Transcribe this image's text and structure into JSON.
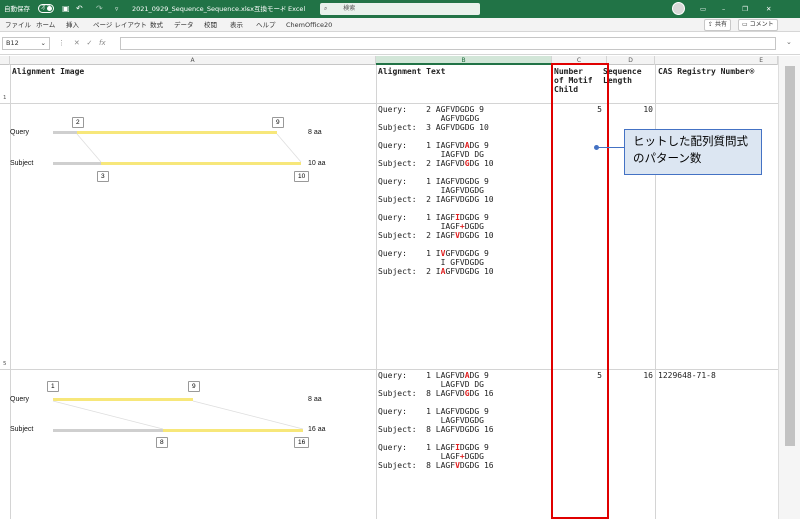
{
  "titlebar": {
    "autosave_label": "自動保存",
    "autosave_state": "オフ",
    "filename": "2021_0929_Sequence_Sequence.xlsx",
    "separator": "-",
    "mode": "互換モード",
    "app": "Excel",
    "search_placeholder": "検索"
  },
  "ribbon": {
    "menus": [
      "ファイル",
      "ホーム",
      "挿入",
      "ページ レイアウト",
      "数式",
      "データ",
      "校閲",
      "表示",
      "ヘルプ",
      "ChemOffice20"
    ],
    "share_label": "共有",
    "comment_label": "コメント"
  },
  "formulabar": {
    "namebox": "B12"
  },
  "columns": [
    "A",
    "B",
    "C",
    "D",
    "E"
  ],
  "rows": [
    "1",
    "5"
  ],
  "headers": {
    "a": "Alignment Image",
    "b": "Alignment Text",
    "c": "Number\nof Motif\nChild",
    "d": "Sequence\nLength",
    "e": "CAS Registry Number®"
  },
  "record1": {
    "image": {
      "query_label": "Query",
      "subject_label": "Subject",
      "query_start": "2",
      "query_end": "9",
      "subject_start": "3",
      "subject_end": "10",
      "query_len": "8 aa",
      "subject_len": "10 aa"
    },
    "motif_count": "5",
    "seq_length": "10",
    "cas": ""
  },
  "record2": {
    "image": {
      "query_label": "Query",
      "subject_label": "Subject",
      "query_start": "1",
      "query_end": "9",
      "subject_start": "8",
      "subject_end": "16",
      "query_len": "8 aa",
      "subject_len": "16 aa"
    },
    "motif_count": "5",
    "seq_length": "16",
    "cas": "1229648-71-8"
  },
  "callout": {
    "line1": "ヒットした配列質問式",
    "line2": "のパターン数"
  },
  "colors": {
    "excel_green": "#217346",
    "highlight_red": "#e00000",
    "callout_fill": "#dce6f2",
    "callout_border": "#4472c4",
    "bar_yellow": "#f7e77a",
    "bar_gray": "#cfcfcf"
  }
}
